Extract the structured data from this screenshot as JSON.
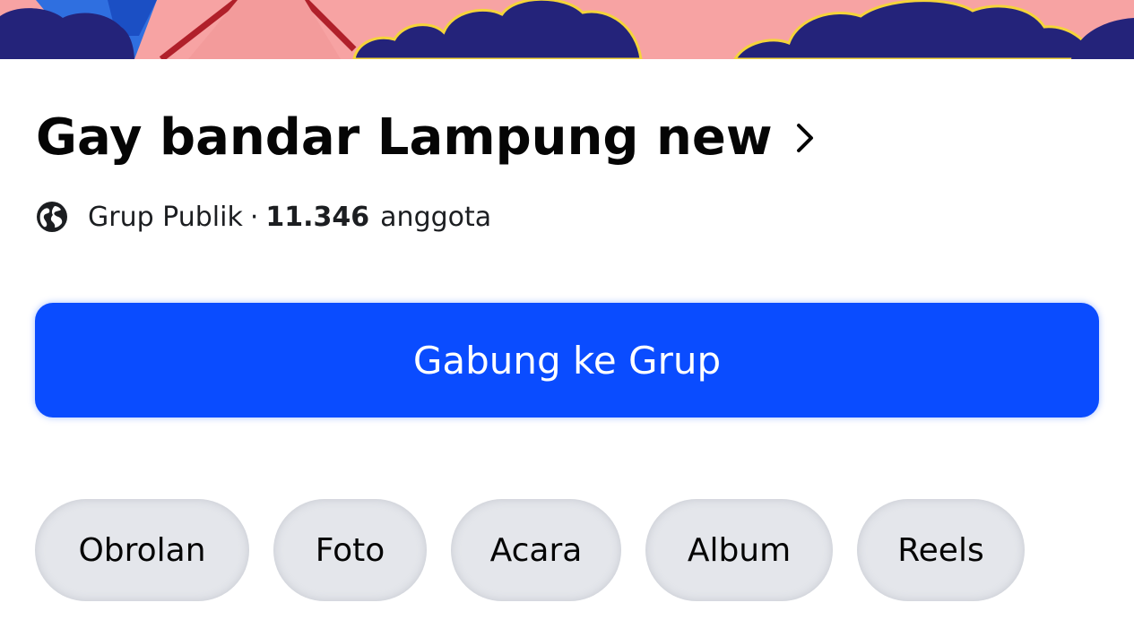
{
  "group": {
    "name": "Gay bandar Lampung new",
    "privacy": "Grup Publik",
    "separator": "·",
    "member_count": "11.346",
    "member_unit": "anggota"
  },
  "actions": {
    "join_label": "Gabung ke Grup"
  },
  "tabs": [
    {
      "label": "Obrolan"
    },
    {
      "label": "Foto"
    },
    {
      "label": "Acara"
    },
    {
      "label": "Album"
    },
    {
      "label": "Reels"
    }
  ],
  "icons": {
    "title_chevron": "chevron-right-icon",
    "privacy": "globe-icon"
  },
  "colors": {
    "primary_button": "#0a4cff",
    "tab_background": "#e4e6eb",
    "cover_pink": "#f7a3a3",
    "cover_navy": "#24237a",
    "cover_blue": "#2f6fe0",
    "cover_red": "#c0282d",
    "cloud_outline": "#f5d43a"
  }
}
